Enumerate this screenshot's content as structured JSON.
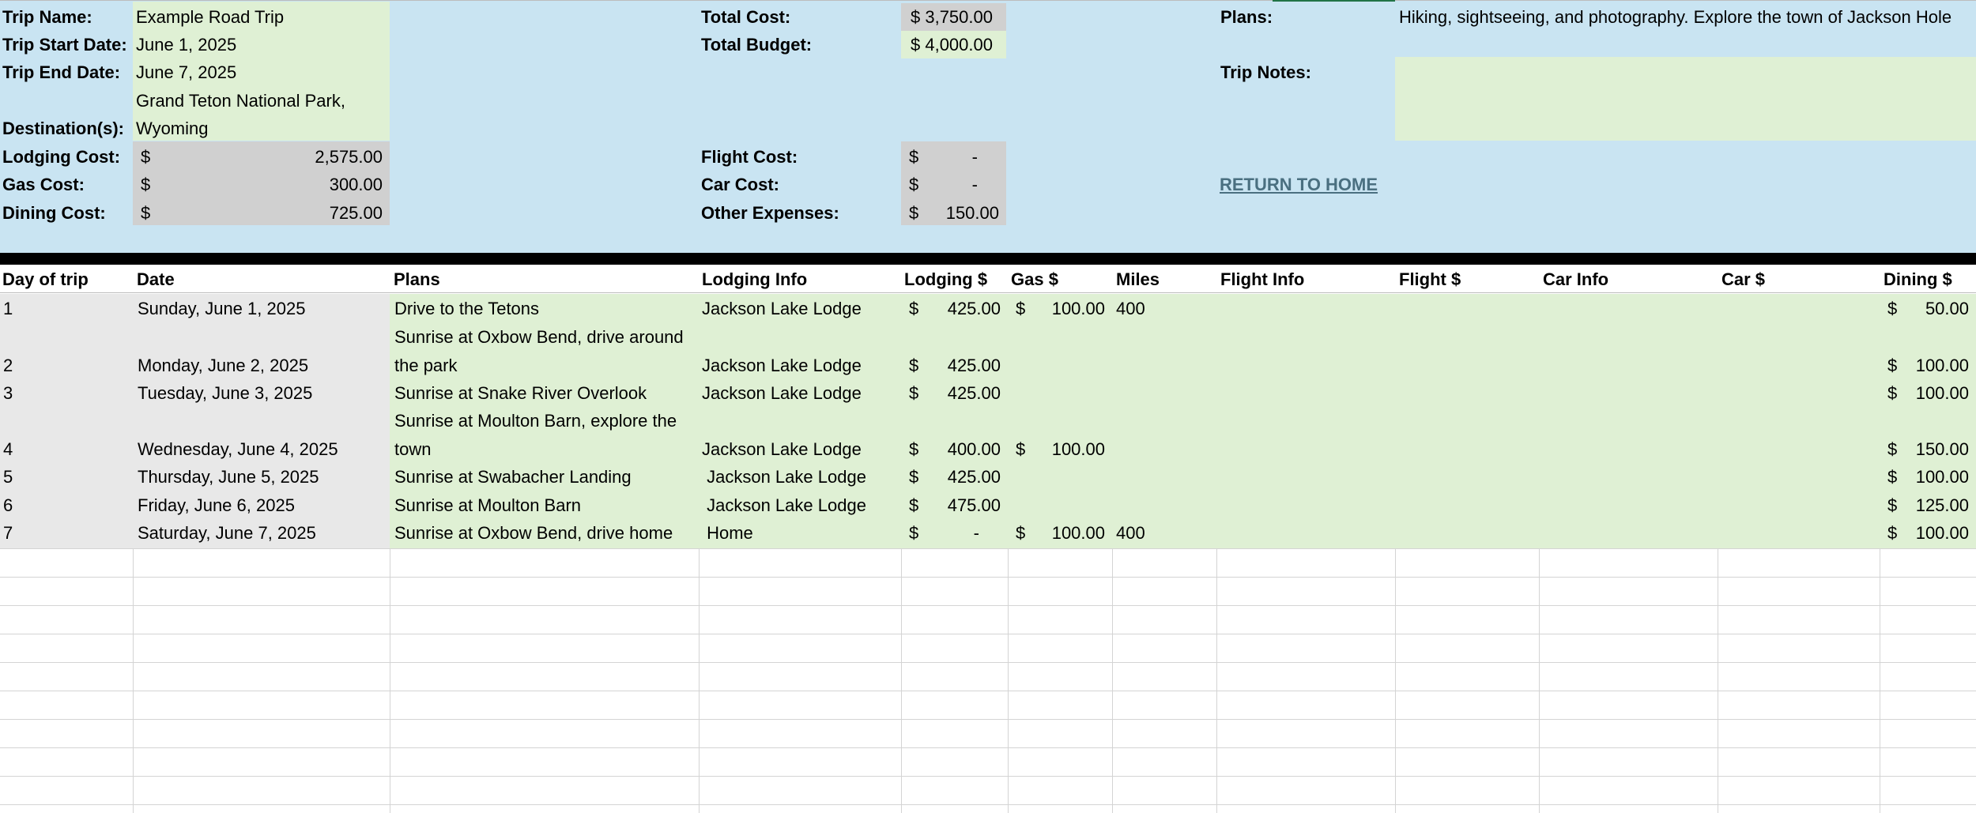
{
  "summary": {
    "trip_name_label": "Trip Name:",
    "trip_name": "Example Road Trip",
    "start_date_label": "Trip Start Date:",
    "start_date": "June 1, 2025",
    "end_date_label": "Trip End Date:",
    "end_date": "June 7, 2025",
    "destination_label": "Destination(s):",
    "destination": "Grand Teton National Park, Wyoming",
    "lodging_cost_label": "Lodging Cost:",
    "lodging_cost": "2,575.00",
    "gas_cost_label": "Gas Cost:",
    "gas_cost": "300.00",
    "dining_cost_label": "Dining Cost:",
    "dining_cost": "725.00",
    "total_cost_label": "Total Cost:",
    "total_cost": "$ 3,750.00",
    "total_budget_label": "Total Budget:",
    "total_budget": "$ 4,000.00",
    "flight_cost_label": "Flight Cost:",
    "flight_cost": "-",
    "car_cost_label": "Car Cost:",
    "car_cost": "-",
    "other_expenses_label": "Other Expenses:",
    "other_expenses": "150.00",
    "plans_label": "Plans:",
    "plans": "Hiking, sightseeing, and photography. Explore the town of Jackson Hole",
    "trip_notes_label": "Trip Notes:",
    "trip_notes": "",
    "return_home": "RETURN TO HOME",
    "currency_symbol": "$"
  },
  "table": {
    "headers": {
      "day": "Day of trip",
      "date": "Date",
      "plans": "Plans",
      "lodging_info": "Lodging Info",
      "lodging_cost": "Lodging $",
      "gas_cost": "Gas $",
      "miles": "Miles",
      "flight_info": "Flight Info",
      "flight_cost": "Flight $",
      "car_info": "Car Info",
      "car_cost": "Car $",
      "dining_cost": "Dining $"
    },
    "rows": [
      {
        "day": "1",
        "date": "Sunday, June 1, 2025",
        "plans_line1": "Drive to the Tetons",
        "plans_line2": "",
        "lodging": "Jackson Lake Lodge",
        "lodging_cost": "425.00",
        "gas_cost": "100.00",
        "miles": "400",
        "dining": "50.00"
      },
      {
        "day": "2",
        "date": "Monday, June 2, 2025",
        "plans_line1": "Sunrise at Oxbow Bend, drive around",
        "plans_line2": "the park",
        "lodging": "Jackson Lake Lodge",
        "lodging_cost": "425.00",
        "gas_cost": "",
        "miles": "",
        "dining": "100.00"
      },
      {
        "day": "3",
        "date": "Tuesday, June 3, 2025",
        "plans_line1": "Sunrise at Snake River Overlook",
        "plans_line2": "",
        "lodging": "Jackson Lake Lodge",
        "lodging_cost": "425.00",
        "gas_cost": "",
        "miles": "",
        "dining": "100.00"
      },
      {
        "day": "4",
        "date": "Wednesday, June 4, 2025",
        "plans_line1": "Sunrise at Moulton Barn, explore the",
        "plans_line2": "town",
        "lodging": "Jackson Lake Lodge",
        "lodging_cost": "400.00",
        "gas_cost": "100.00",
        "miles": "",
        "dining": "150.00"
      },
      {
        "day": "5",
        "date": "Thursday, June 5, 2025",
        "plans_line1": "Sunrise at Swabacher Landing",
        "plans_line2": "",
        "lodging": " Jackson Lake Lodge",
        "lodging_cost": "425.00",
        "gas_cost": "",
        "miles": "",
        "dining": "100.00"
      },
      {
        "day": "6",
        "date": "Friday, June 6, 2025",
        "plans_line1": "Sunrise at Moulton Barn",
        "plans_line2": "",
        "lodging": " Jackson Lake Lodge",
        "lodging_cost": "475.00",
        "gas_cost": "",
        "miles": "",
        "dining": "125.00"
      },
      {
        "day": "7",
        "date": "Saturday, June 7, 2025",
        "plans_line1": "Sunrise at Oxbow Bend, drive home",
        "plans_line2": "",
        "lodging": " Home",
        "lodging_cost": "-",
        "gas_cost": "100.00",
        "miles": "400",
        "dining": "100.00"
      }
    ]
  }
}
